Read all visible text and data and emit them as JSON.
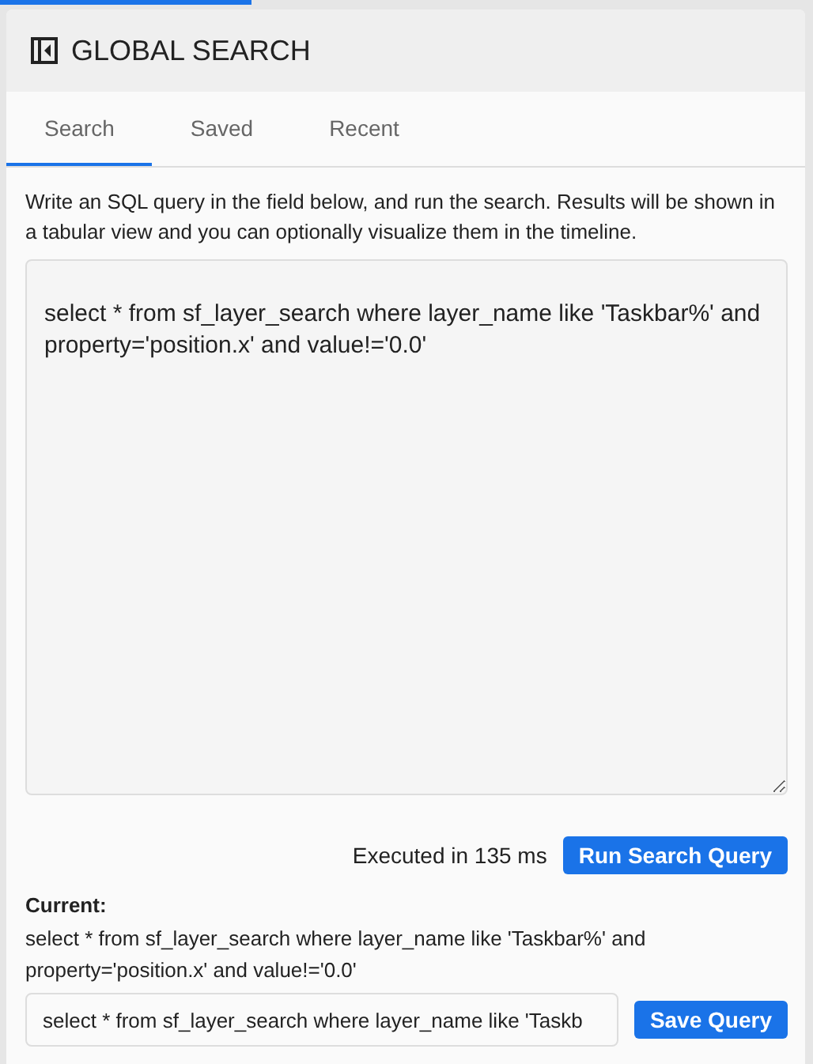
{
  "progress": {
    "level": 0.31
  },
  "panel": {
    "title": "GLOBAL SEARCH"
  },
  "tabs": [
    {
      "label": "Search",
      "selected": true
    },
    {
      "label": "Saved",
      "selected": false
    },
    {
      "label": "Recent",
      "selected": false
    }
  ],
  "description": "Write an SQL query in the field below, and run the search. Results will be shown in a tabular view and you can optionally visualize them in the timeline.",
  "query_field": {
    "value": "select * from sf_layer_search where layer_name like 'Taskbar%' and property='position.x' and value!='0.0'"
  },
  "status": "Executed in 135 ms",
  "run_button": "Run Search Query",
  "current": {
    "label": "Current:",
    "query": "select * from sf_layer_search where layer_name like 'Taskbar%' and property='position.x' and value!='0.0'"
  },
  "save_field": {
    "value": "select * from sf_layer_search where layer_name like 'Taskb"
  },
  "save_button": "Save Query"
}
